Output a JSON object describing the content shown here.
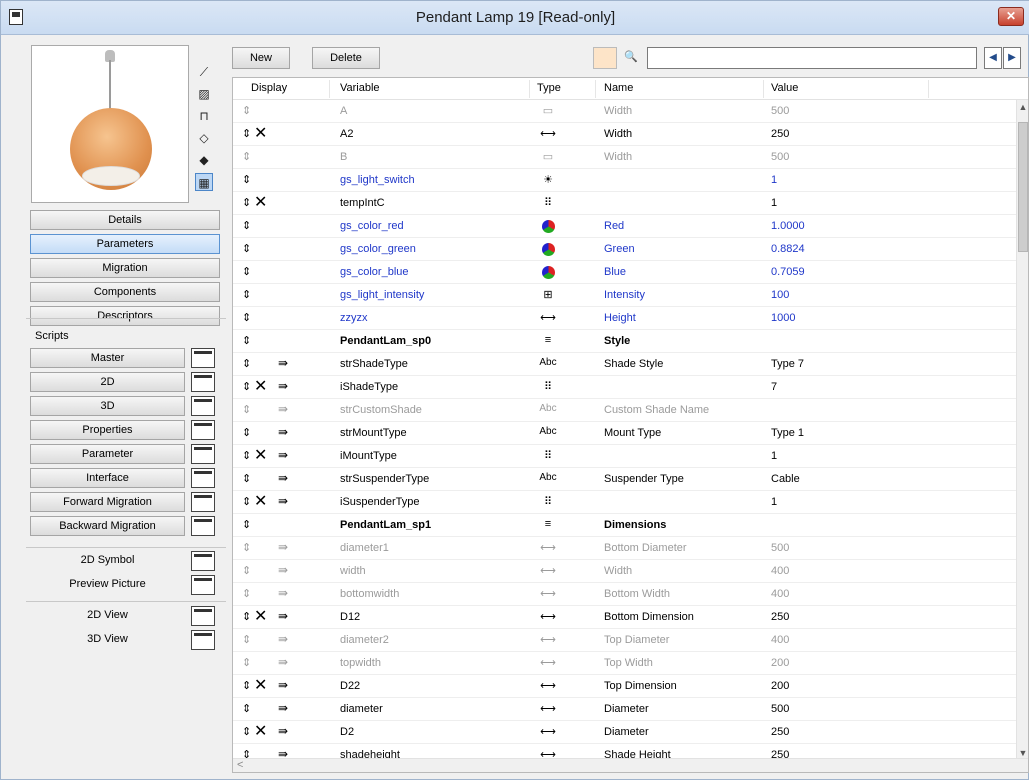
{
  "window": {
    "title": "Pendant Lamp 19 [Read-only]",
    "close_label": "✕"
  },
  "left": {
    "tool_icons": [
      "cursor-icon",
      "eraser-icon",
      "chair-icon",
      "cube-wire-icon",
      "cube-solid-icon",
      "film-icon"
    ],
    "sections": [
      "Details",
      "Parameters",
      "Migration",
      "Components",
      "Descriptors"
    ],
    "selected_section": "Parameters",
    "scripts_label": "Scripts",
    "scripts": [
      "Master",
      "2D",
      "3D",
      "Properties",
      "Parameter",
      "Interface",
      "Forward Migration",
      "Backward Migration"
    ],
    "extras": [
      "2D Symbol",
      "Preview Picture"
    ],
    "views": [
      "2D View",
      "3D View"
    ]
  },
  "toolbar": {
    "new_label": "New",
    "delete_label": "Delete",
    "search_glyph": "🔍",
    "search_value": "",
    "prev_glyph": "◀",
    "next_glyph": "▶"
  },
  "grid": {
    "headers": {
      "display": "Display",
      "variable": "Variable",
      "type": "Type",
      "name": "Name",
      "value": "Value"
    },
    "rows": [
      {
        "drag": "⇕",
        "x": "",
        "ind": "",
        "var": "A",
        "type": "▭",
        "name": "Width",
        "val": "500",
        "style": "dim"
      },
      {
        "drag": "⇕",
        "x": "✕",
        "ind": "",
        "var": "A2",
        "type": "⟷",
        "name": "Width",
        "val": "250",
        "style": ""
      },
      {
        "drag": "⇕",
        "x": "",
        "ind": "",
        "var": "B",
        "type": "▭",
        "name": "Width",
        "val": "500",
        "style": "dim"
      },
      {
        "drag": "⇕",
        "x": "",
        "ind": "",
        "var": "gs_light_switch",
        "type": "☀",
        "name": "",
        "val": "1",
        "style": "blue"
      },
      {
        "drag": "⇕",
        "x": "✕",
        "ind": "",
        "var": "tempIntC",
        "type": "⠿",
        "name": "",
        "val": "1",
        "style": ""
      },
      {
        "drag": "⇕",
        "x": "",
        "ind": "",
        "var": "gs_color_red",
        "type": "pie",
        "name": "Red",
        "val": "1.0000",
        "style": "blue"
      },
      {
        "drag": "⇕",
        "x": "",
        "ind": "",
        "var": "gs_color_green",
        "type": "pie",
        "name": "Green",
        "val": "0.8824",
        "style": "blue"
      },
      {
        "drag": "⇕",
        "x": "",
        "ind": "",
        "var": "gs_color_blue",
        "type": "pie",
        "name": "Blue",
        "val": "0.7059",
        "style": "blue"
      },
      {
        "drag": "⇕",
        "x": "",
        "ind": "",
        "var": "gs_light_intensity",
        "type": "⊞",
        "name": "Intensity",
        "val": "100",
        "style": "blue"
      },
      {
        "drag": "⇕",
        "x": "",
        "ind": "",
        "var": "zzyzx",
        "type": "⟷",
        "name": "Height",
        "val": "1000",
        "style": "blue"
      },
      {
        "drag": "⇕",
        "x": "",
        "ind": "",
        "var": "PendantLam_sp0",
        "type": "≡",
        "name": "Style",
        "val": "",
        "style": "bold"
      },
      {
        "drag": "⇕",
        "x": "",
        "ind": "⇛",
        "var": "strShadeType",
        "type": "Abc",
        "name": "Shade Style",
        "val": "Type 7",
        "style": ""
      },
      {
        "drag": "⇕",
        "x": "✕",
        "ind": "⇛",
        "var": "iShadeType",
        "type": "⠿",
        "name": "",
        "val": "7",
        "style": ""
      },
      {
        "drag": "⇕",
        "x": "",
        "ind": "⇛",
        "var": "strCustomShade",
        "type": "Abc",
        "name": "Custom Shade Name",
        "val": "",
        "style": "dim"
      },
      {
        "drag": "⇕",
        "x": "",
        "ind": "⇛",
        "var": "strMountType",
        "type": "Abc",
        "name": "Mount Type",
        "val": "Type 1",
        "style": ""
      },
      {
        "drag": "⇕",
        "x": "✕",
        "ind": "⇛",
        "var": "iMountType",
        "type": "⠿",
        "name": "",
        "val": "1",
        "style": ""
      },
      {
        "drag": "⇕",
        "x": "",
        "ind": "⇛",
        "var": "strSuspenderType",
        "type": "Abc",
        "name": "Suspender Type",
        "val": "Cable",
        "style": ""
      },
      {
        "drag": "⇕",
        "x": "✕",
        "ind": "⇛",
        "var": "iSuspenderType",
        "type": "⠿",
        "name": "",
        "val": "1",
        "style": ""
      },
      {
        "drag": "⇕",
        "x": "",
        "ind": "",
        "var": "PendantLam_sp1",
        "type": "≡",
        "name": "Dimensions",
        "val": "",
        "style": "bold"
      },
      {
        "drag": "⇕",
        "x": "",
        "ind": "⇛",
        "var": "diameter1",
        "type": "⟷",
        "name": "Bottom Diameter",
        "val": "500",
        "style": "dim"
      },
      {
        "drag": "⇕",
        "x": "",
        "ind": "⇛",
        "var": "width",
        "type": "⟷",
        "name": "Width",
        "val": "400",
        "style": "dim"
      },
      {
        "drag": "⇕",
        "x": "",
        "ind": "⇛",
        "var": "bottomwidth",
        "type": "⟷",
        "name": "Bottom Width",
        "val": "400",
        "style": "dim"
      },
      {
        "drag": "⇕",
        "x": "✕",
        "ind": "⇛",
        "var": "D12",
        "type": "⟷",
        "name": "Bottom Dimension",
        "val": "250",
        "style": ""
      },
      {
        "drag": "⇕",
        "x": "",
        "ind": "⇛",
        "var": "diameter2",
        "type": "⟷",
        "name": "Top Diameter",
        "val": "400",
        "style": "dim"
      },
      {
        "drag": "⇕",
        "x": "",
        "ind": "⇛",
        "var": "topwidth",
        "type": "⟷",
        "name": "Top Width",
        "val": "200",
        "style": "dim"
      },
      {
        "drag": "⇕",
        "x": "✕",
        "ind": "⇛",
        "var": "D22",
        "type": "⟷",
        "name": "Top Dimension",
        "val": "200",
        "style": ""
      },
      {
        "drag": "⇕",
        "x": "",
        "ind": "⇛",
        "var": "diameter",
        "type": "⟷",
        "name": "Diameter",
        "val": "500",
        "style": ""
      },
      {
        "drag": "⇕",
        "x": "✕",
        "ind": "⇛",
        "var": "D2",
        "type": "⟷",
        "name": "Diameter",
        "val": "250",
        "style": ""
      },
      {
        "drag": "⇕",
        "x": "",
        "ind": "⇛",
        "var": "shadeheight",
        "type": "⟷",
        "name": "Shade Height",
        "val": "250",
        "style": ""
      }
    ]
  },
  "scroll": {
    "up": "▲",
    "down": "▼",
    "left": "<"
  }
}
